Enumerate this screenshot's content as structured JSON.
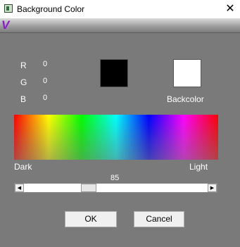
{
  "window": {
    "title": "Background Color",
    "close_glyph": "✕",
    "icon": "app-icon"
  },
  "banner": {
    "logo_glyph": "V",
    "accent_color": "#8c1cc7"
  },
  "rgb": {
    "r_label": "R",
    "r_value": "0",
    "g_label": "G",
    "g_value": "0",
    "b_label": "B",
    "b_value": "0"
  },
  "swatches": {
    "current_color": "#000000",
    "back_color": "#ffffff",
    "back_label": "Backcolor"
  },
  "spectrum": {
    "dark_label": "Dark",
    "light_label": "Light"
  },
  "brightness": {
    "value": "85",
    "fraction": 0.34,
    "left_arrow": "◀",
    "right_arrow": "▶"
  },
  "buttons": {
    "ok_label": "OK",
    "cancel_label": "Cancel"
  }
}
